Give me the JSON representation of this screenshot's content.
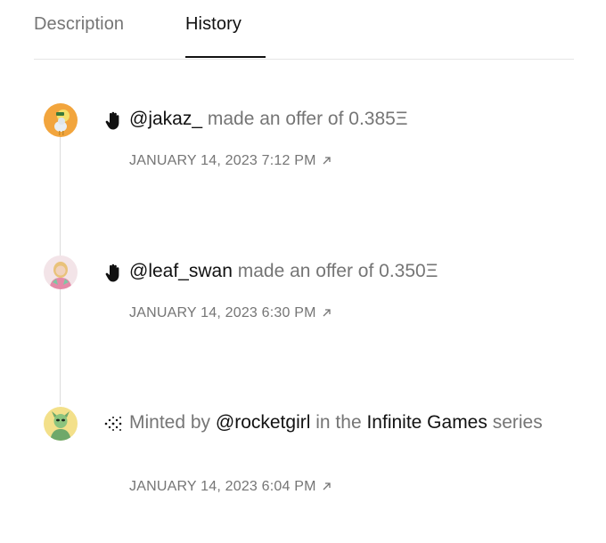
{
  "tabs": {
    "description": "Description",
    "history": "History"
  },
  "history": {
    "events": [
      {
        "icon": "hand-icon",
        "user": "@jakaz_",
        "text": "made an offer of",
        "amount": "0.385Ξ",
        "date": "JANUARY 14, 2023 7:12 PM"
      },
      {
        "icon": "hand-icon",
        "user": "@leaf_swan",
        "text": "made an offer of",
        "amount": "0.350Ξ",
        "date": "JANUARY 14, 2023 6:30 PM"
      },
      {
        "icon": "mint-sparkle-icon",
        "prefix": "Minted by",
        "user": "@rocketgirl",
        "mid": "in the",
        "series_name": "Infinite Games",
        "suffix": "series",
        "date": "JANUARY 14, 2023 6:04 PM"
      }
    ]
  },
  "colors": {
    "text_primary": "#111111",
    "text_muted": "#757575",
    "divider": "#e6e6e6",
    "timeline": "#dcdcdc"
  }
}
